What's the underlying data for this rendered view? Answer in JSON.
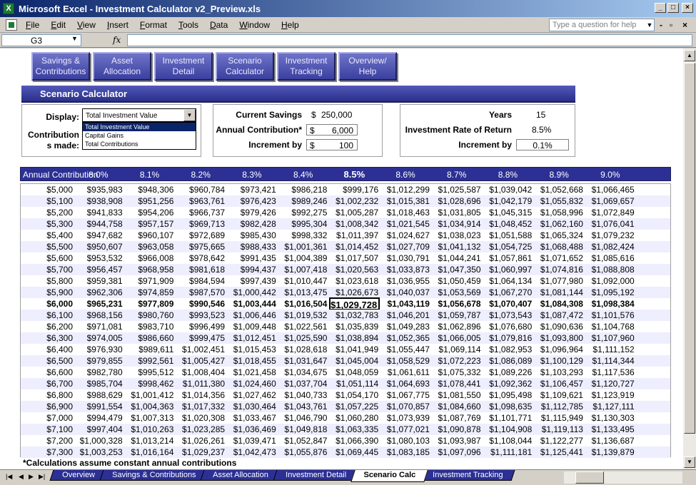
{
  "window": {
    "title": "Microsoft Excel - Investment Calculator v2_Preview.xls"
  },
  "menu": [
    "File",
    "Edit",
    "View",
    "Insert",
    "Format",
    "Tools",
    "Data",
    "Window",
    "Help"
  ],
  "ask_placeholder": "Type a question for help",
  "namebox": "G3",
  "fx": "fx",
  "nav_buttons": [
    "Savings &\nContributions",
    "Asset\nAllocation",
    "Investment\nDetail",
    "Scenario\nCalculator",
    "Investment\nTracking",
    "Overview/\nHelp"
  ],
  "section_title": "Scenario Calculator",
  "display": {
    "label": "Display:",
    "value": "Total Investment Value",
    "contrib_label_1": "Contribution",
    "contrib_label_2": "s made:",
    "options": [
      "Total Investment Value",
      "Capital Gains",
      "Total Contributions"
    ],
    "selected_index": 0
  },
  "savings": {
    "current_label": "Current Savings",
    "current_cur": "$",
    "current_value": "250,000",
    "annual_label": "Annual Contribution*",
    "annual_cur": "$",
    "annual_value": "6,000",
    "increment_label": "Increment by",
    "increment_cur": "$",
    "increment_value": "100"
  },
  "rates": {
    "years_label": "Years",
    "years_value": "15",
    "rate_label": "Investment Rate of Return",
    "rate_value": "8.5%",
    "increment_label": "Increment by",
    "increment_value": "0.1%"
  },
  "table": {
    "header_label": "Annual Contribution",
    "rates": [
      "8.0%",
      "8.1%",
      "8.2%",
      "8.3%",
      "8.4%",
      "8.5%",
      "8.6%",
      "8.7%",
      "8.8%",
      "8.9%",
      "9.0%"
    ],
    "highlight_rate_index": 5,
    "highlight_row_index": 10,
    "rows": [
      {
        "c": "$5,000",
        "v": [
          "$935,983",
          "$948,306",
          "$960,784",
          "$973,421",
          "$986,218",
          "$999,176",
          "$1,012,299",
          "$1,025,587",
          "$1,039,042",
          "$1,052,668",
          "$1,066,465"
        ]
      },
      {
        "c": "$5,100",
        "v": [
          "$938,908",
          "$951,256",
          "$963,761",
          "$976,423",
          "$989,246",
          "$1,002,232",
          "$1,015,381",
          "$1,028,696",
          "$1,042,179",
          "$1,055,832",
          "$1,069,657"
        ]
      },
      {
        "c": "$5,200",
        "v": [
          "$941,833",
          "$954,206",
          "$966,737",
          "$979,426",
          "$992,275",
          "$1,005,287",
          "$1,018,463",
          "$1,031,805",
          "$1,045,315",
          "$1,058,996",
          "$1,072,849"
        ]
      },
      {
        "c": "$5,300",
        "v": [
          "$944,758",
          "$957,157",
          "$969,713",
          "$982,428",
          "$995,304",
          "$1,008,342",
          "$1,021,545",
          "$1,034,914",
          "$1,048,452",
          "$1,062,160",
          "$1,076,041"
        ]
      },
      {
        "c": "$5,400",
        "v": [
          "$947,682",
          "$960,107",
          "$972,689",
          "$985,430",
          "$998,332",
          "$1,011,397",
          "$1,024,627",
          "$1,038,023",
          "$1,051,588",
          "$1,065,324",
          "$1,079,232"
        ]
      },
      {
        "c": "$5,500",
        "v": [
          "$950,607",
          "$963,058",
          "$975,665",
          "$988,433",
          "$1,001,361",
          "$1,014,452",
          "$1,027,709",
          "$1,041,132",
          "$1,054,725",
          "$1,068,488",
          "$1,082,424"
        ]
      },
      {
        "c": "$5,600",
        "v": [
          "$953,532",
          "$966,008",
          "$978,642",
          "$991,435",
          "$1,004,389",
          "$1,017,507",
          "$1,030,791",
          "$1,044,241",
          "$1,057,861",
          "$1,071,652",
          "$1,085,616"
        ]
      },
      {
        "c": "$5,700",
        "v": [
          "$956,457",
          "$968,958",
          "$981,618",
          "$994,437",
          "$1,007,418",
          "$1,020,563",
          "$1,033,873",
          "$1,047,350",
          "$1,060,997",
          "$1,074,816",
          "$1,088,808"
        ]
      },
      {
        "c": "$5,800",
        "v": [
          "$959,381",
          "$971,909",
          "$984,594",
          "$997,439",
          "$1,010,447",
          "$1,023,618",
          "$1,036,955",
          "$1,050,459",
          "$1,064,134",
          "$1,077,980",
          "$1,092,000"
        ]
      },
      {
        "c": "$5,900",
        "v": [
          "$962,306",
          "$974,859",
          "$987,570",
          "$1,000,442",
          "$1,013,475",
          "$1,026,673",
          "$1,040,037",
          "$1,053,569",
          "$1,067,270",
          "$1,081,144",
          "$1,095,192"
        ]
      },
      {
        "c": "$6,000",
        "v": [
          "$965,231",
          "$977,809",
          "$990,546",
          "$1,003,444",
          "$1,016,504",
          "$1,029,728",
          "$1,043,119",
          "$1,056,678",
          "$1,070,407",
          "$1,084,308",
          "$1,098,384"
        ]
      },
      {
        "c": "$6,100",
        "v": [
          "$968,156",
          "$980,760",
          "$993,523",
          "$1,006,446",
          "$1,019,532",
          "$1,032,783",
          "$1,046,201",
          "$1,059,787",
          "$1,073,543",
          "$1,087,472",
          "$1,101,576"
        ]
      },
      {
        "c": "$6,200",
        "v": [
          "$971,081",
          "$983,710",
          "$996,499",
          "$1,009,448",
          "$1,022,561",
          "$1,035,839",
          "$1,049,283",
          "$1,062,896",
          "$1,076,680",
          "$1,090,636",
          "$1,104,768"
        ]
      },
      {
        "c": "$6,300",
        "v": [
          "$974,005",
          "$986,660",
          "$999,475",
          "$1,012,451",
          "$1,025,590",
          "$1,038,894",
          "$1,052,365",
          "$1,066,005",
          "$1,079,816",
          "$1,093,800",
          "$1,107,960"
        ]
      },
      {
        "c": "$6,400",
        "v": [
          "$976,930",
          "$989,611",
          "$1,002,451",
          "$1,015,453",
          "$1,028,618",
          "$1,041,949",
          "$1,055,447",
          "$1,069,114",
          "$1,082,953",
          "$1,096,964",
          "$1,111,152"
        ]
      },
      {
        "c": "$6,500",
        "v": [
          "$979,855",
          "$992,561",
          "$1,005,427",
          "$1,018,455",
          "$1,031,647",
          "$1,045,004",
          "$1,058,529",
          "$1,072,223",
          "$1,086,089",
          "$1,100,129",
          "$1,114,344"
        ]
      },
      {
        "c": "$6,600",
        "v": [
          "$982,780",
          "$995,512",
          "$1,008,404",
          "$1,021,458",
          "$1,034,675",
          "$1,048,059",
          "$1,061,611",
          "$1,075,332",
          "$1,089,226",
          "$1,103,293",
          "$1,117,536"
        ]
      },
      {
        "c": "$6,700",
        "v": [
          "$985,704",
          "$998,462",
          "$1,011,380",
          "$1,024,460",
          "$1,037,704",
          "$1,051,114",
          "$1,064,693",
          "$1,078,441",
          "$1,092,362",
          "$1,106,457",
          "$1,120,727"
        ]
      },
      {
        "c": "$6,800",
        "v": [
          "$988,629",
          "$1,001,412",
          "$1,014,356",
          "$1,027,462",
          "$1,040,733",
          "$1,054,170",
          "$1,067,775",
          "$1,081,550",
          "$1,095,498",
          "$1,109,621",
          "$1,123,919"
        ]
      },
      {
        "c": "$6,900",
        "v": [
          "$991,554",
          "$1,004,363",
          "$1,017,332",
          "$1,030,464",
          "$1,043,761",
          "$1,057,225",
          "$1,070,857",
          "$1,084,660",
          "$1,098,635",
          "$1,112,785",
          "$1,127,111"
        ]
      },
      {
        "c": "$7,000",
        "v": [
          "$994,479",
          "$1,007,313",
          "$1,020,308",
          "$1,033,467",
          "$1,046,790",
          "$1,060,280",
          "$1,073,939",
          "$1,087,769",
          "$1,101,771",
          "$1,115,949",
          "$1,130,303"
        ]
      },
      {
        "c": "$7,100",
        "v": [
          "$997,404",
          "$1,010,263",
          "$1,023,285",
          "$1,036,469",
          "$1,049,818",
          "$1,063,335",
          "$1,077,021",
          "$1,090,878",
          "$1,104,908",
          "$1,119,113",
          "$1,133,495"
        ]
      },
      {
        "c": "$7,200",
        "v": [
          "$1,000,328",
          "$1,013,214",
          "$1,026,261",
          "$1,039,471",
          "$1,052,847",
          "$1,066,390",
          "$1,080,103",
          "$1,093,987",
          "$1,108,044",
          "$1,122,277",
          "$1,136,687"
        ]
      },
      {
        "c": "$7,300",
        "v": [
          "$1,003,253",
          "$1,016,164",
          "$1,029,237",
          "$1,042,473",
          "$1,055,876",
          "$1,069,445",
          "$1,083,185",
          "$1,097,096",
          "$1,111,181",
          "$1,125,441",
          "$1,139,879"
        ]
      }
    ]
  },
  "footnote": "*Calculations assume constant annual contributions",
  "sheet_tabs": [
    "Overview",
    "Savings & Contributions",
    "Asset Allocation",
    "Investment Detail",
    "Scenario Calc",
    "Investment Tracking"
  ],
  "active_tab_index": 4
}
